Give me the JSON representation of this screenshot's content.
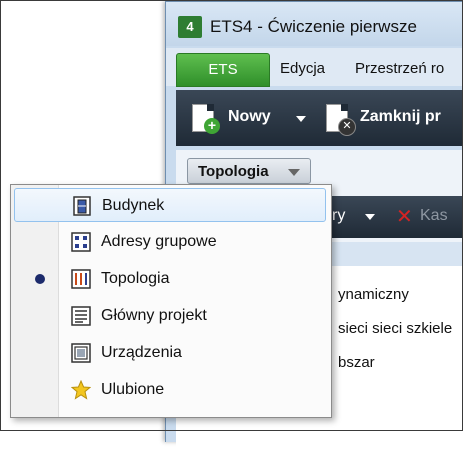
{
  "window": {
    "logo_text": "4",
    "title": "ETS4 - Ćwiczenie pierwsze"
  },
  "menubar": {
    "ets_tab": "ETS",
    "items": [
      "Edycja",
      "Przestrzeń ro"
    ]
  },
  "toolbar": {
    "new_label": "Nowy",
    "close_label": "Zamknij pr"
  },
  "panel": {
    "tab_label": "Topologia",
    "toolbar_fragment": "ry",
    "delete_fragment": "Kas",
    "rows": [
      "ynamiczny",
      "sieci sieci szkiele",
      "bszar"
    ]
  },
  "popup": {
    "items": [
      {
        "label": "Budynek",
        "icon": "building-icon",
        "highlighted": true,
        "selected": false
      },
      {
        "label": "Adresy grupowe",
        "icon": "group-addresses-icon",
        "highlighted": false,
        "selected": false
      },
      {
        "label": "Topologia",
        "icon": "topology-icon",
        "highlighted": false,
        "selected": true
      },
      {
        "label": "Główny projekt",
        "icon": "project-list-icon",
        "highlighted": false,
        "selected": false
      },
      {
        "label": "Urządzenia",
        "icon": "devices-icon",
        "highlighted": false,
        "selected": false
      },
      {
        "label": "Ulubione",
        "icon": "star-icon",
        "highlighted": false,
        "selected": false
      }
    ]
  },
  "colors": {
    "menu_green": "#2f8f2a",
    "toolbar_dark": "#1f2a36",
    "highlight_border": "#93c2ee",
    "bullet": "#1c2a6b",
    "delete_red": "#d42323"
  }
}
